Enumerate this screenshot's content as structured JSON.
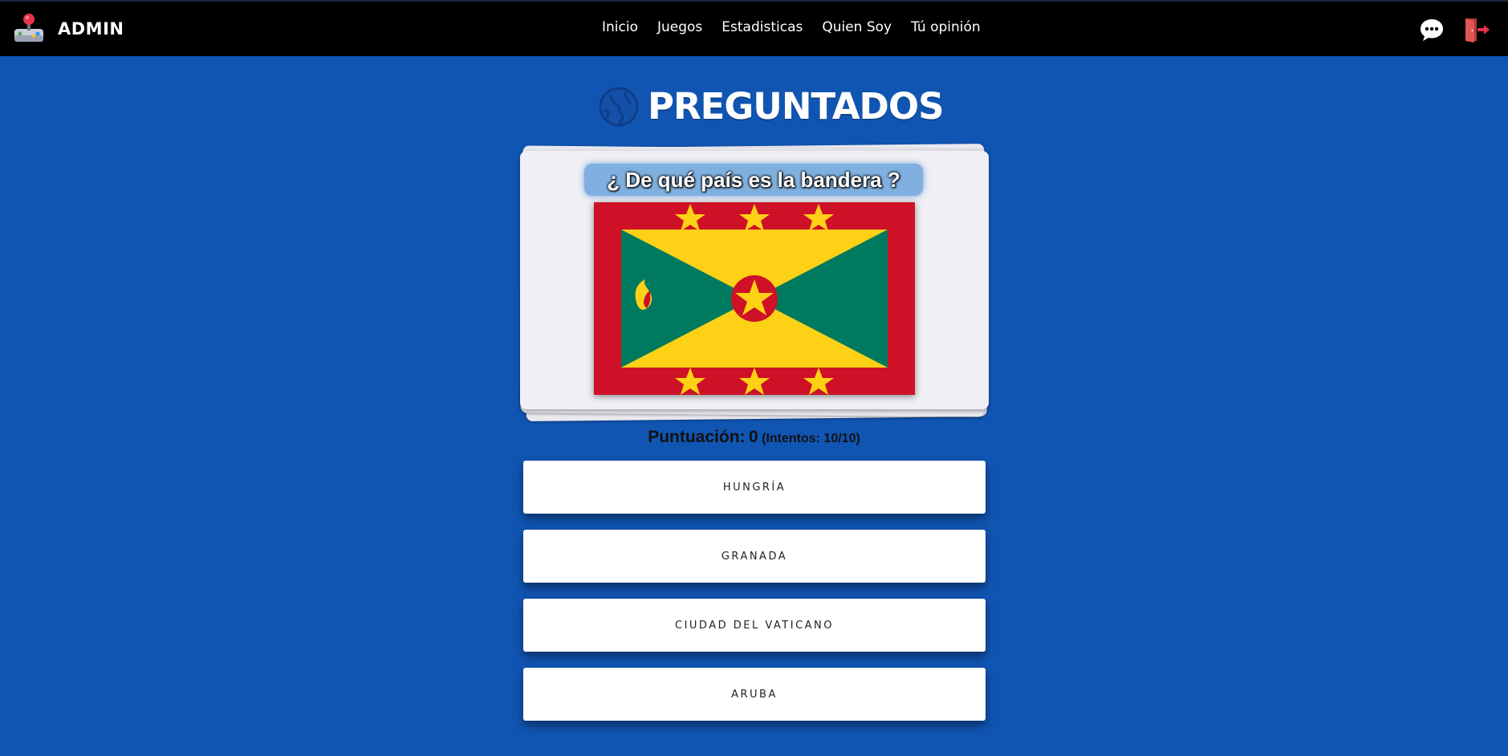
{
  "navbar": {
    "brand": "ADMIN",
    "links": [
      "Inicio",
      "Juegos",
      "Estadisticas",
      "Quien Soy",
      "Tú opinión"
    ]
  },
  "game": {
    "title": "PREGUNTADOS",
    "question": "¿ De qué país es la bandera ?",
    "flag_country": "Grenada"
  },
  "score": {
    "label": "Puntuación:",
    "value": "0",
    "attempts": "(Intentos: 10/10)"
  },
  "answers": [
    "HUNGRÍA",
    "GRANADA",
    "CIUDAD DEL VATICANO",
    "ARUBA"
  ],
  "colors": {
    "background": "#1155b3",
    "navbar": "#000000",
    "flag_red": "#ce1126",
    "flag_yellow": "#fcd116",
    "flag_green": "#007a5e"
  }
}
